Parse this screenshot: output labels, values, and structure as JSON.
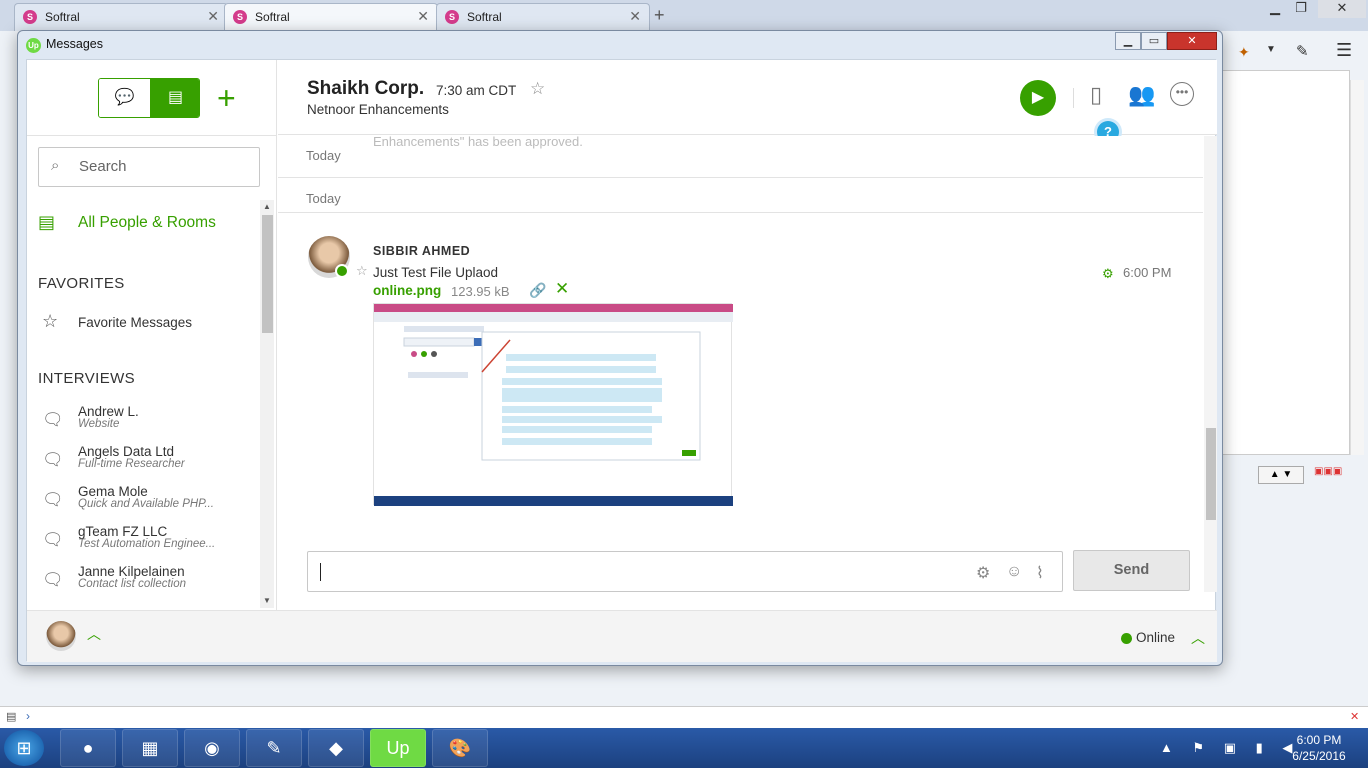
{
  "browser": {
    "tabs": [
      {
        "label": "Softral"
      },
      {
        "label": "Softral"
      },
      {
        "label": "Softral"
      }
    ],
    "new_tab": "+"
  },
  "window": {
    "title": "Messages",
    "logo": "Up"
  },
  "sidebar": {
    "search_placeholder": "Search",
    "all_people": "All People & Rooms",
    "favorites_heading": "FAVORITES",
    "favorite_messages": "Favorite Messages",
    "interviews_heading": "INTERVIEWS",
    "interviews": [
      {
        "name": "Andrew L.",
        "sub": "Website"
      },
      {
        "name": "Angels Data Ltd",
        "sub": "Full-time Researcher"
      },
      {
        "name": "Gema Mole",
        "sub": "Quick and Available PHP..."
      },
      {
        "name": "gTeam FZ LLC",
        "sub": "Test Automation Enginee..."
      },
      {
        "name": "Janne Kilpelainen",
        "sub": "Contact list collection"
      }
    ]
  },
  "header": {
    "name": "Shaikh Corp.",
    "time": "7:30 am CDT",
    "subtitle": "Netnoor Enhancements",
    "help": "?"
  },
  "messages": {
    "ghost_text": "Enhancements\" has been approved.",
    "date_label_1": "Today",
    "date_label_2": "Today",
    "sender": "SIBBIR AHMED",
    "text": "Just Test File Uplaod",
    "time": "6:00 PM",
    "file_name": "online.png",
    "file_size": "123.95 kB"
  },
  "composer": {
    "send_label": "Send"
  },
  "footer": {
    "status": "Online"
  },
  "taskbar": {
    "time": "6:00 PM",
    "date": "6/25/2016"
  },
  "colors": {
    "accent": "#37a000",
    "help": "#29a9e0"
  }
}
